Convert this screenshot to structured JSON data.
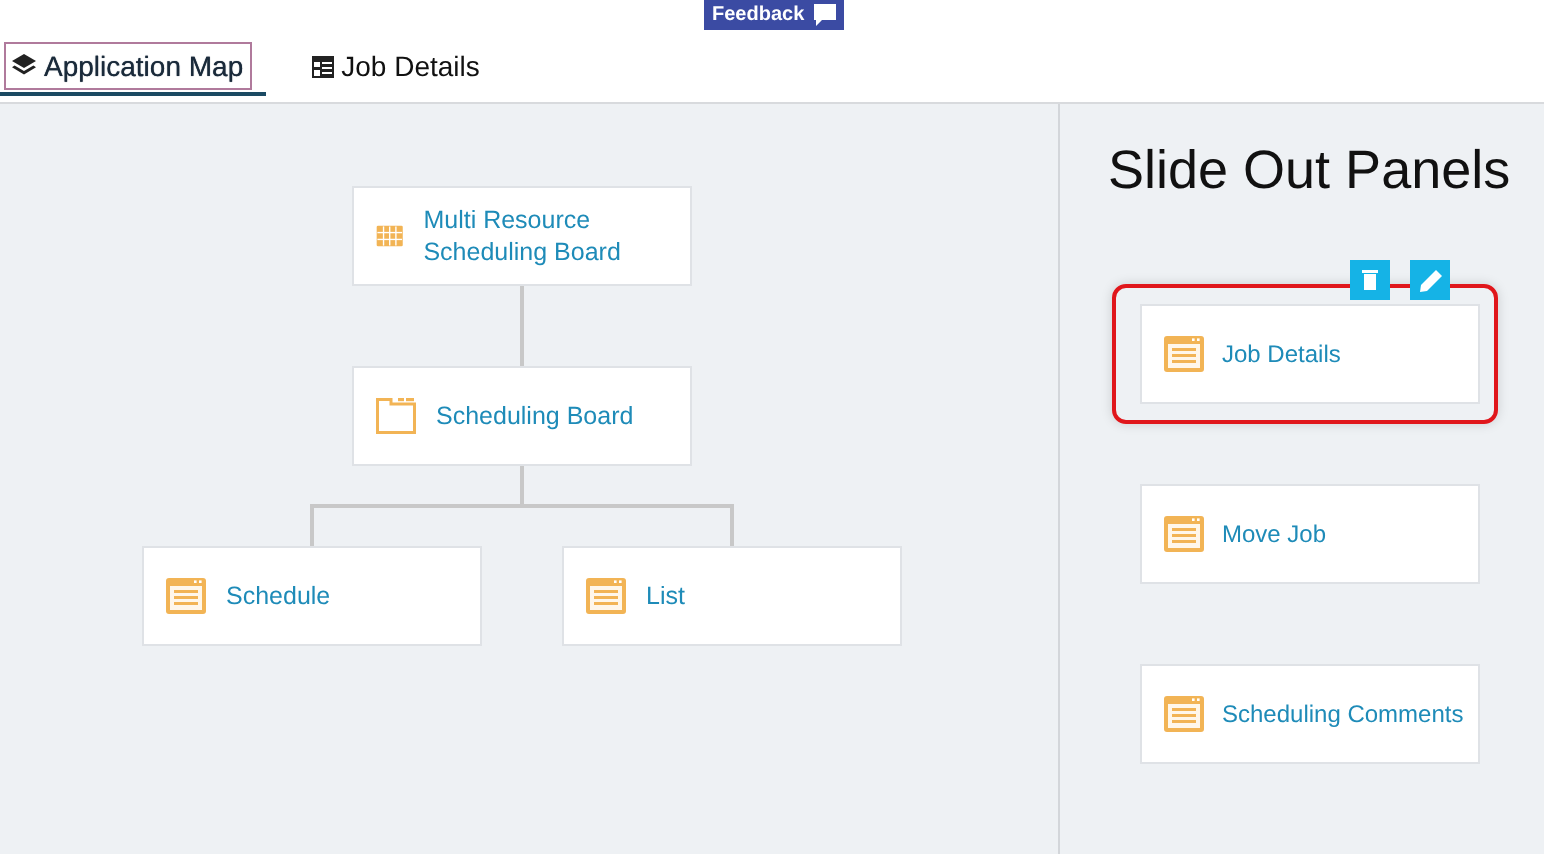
{
  "feedback_button": {
    "label": "Feedback"
  },
  "tabs": [
    {
      "label": "Application Map",
      "kind": "layers",
      "selected": true
    },
    {
      "label": "Job Details",
      "kind": "table",
      "selected": false
    }
  ],
  "application_map": {
    "root": {
      "label": "Multi Resource Scheduling Board",
      "kind": "grid",
      "children": [
        {
          "label": "Scheduling Board",
          "kind": "folder",
          "children": [
            {
              "label": "Schedule",
              "kind": "window"
            },
            {
              "label": "List",
              "kind": "window"
            }
          ]
        }
      ]
    }
  },
  "slide_out_panels": {
    "title": "Slide Out Panels",
    "panels": [
      {
        "label": "Job Details",
        "selected": true
      },
      {
        "label": "Move Job",
        "selected": false
      },
      {
        "label": "Scheduling Comments",
        "selected": false
      }
    ]
  }
}
